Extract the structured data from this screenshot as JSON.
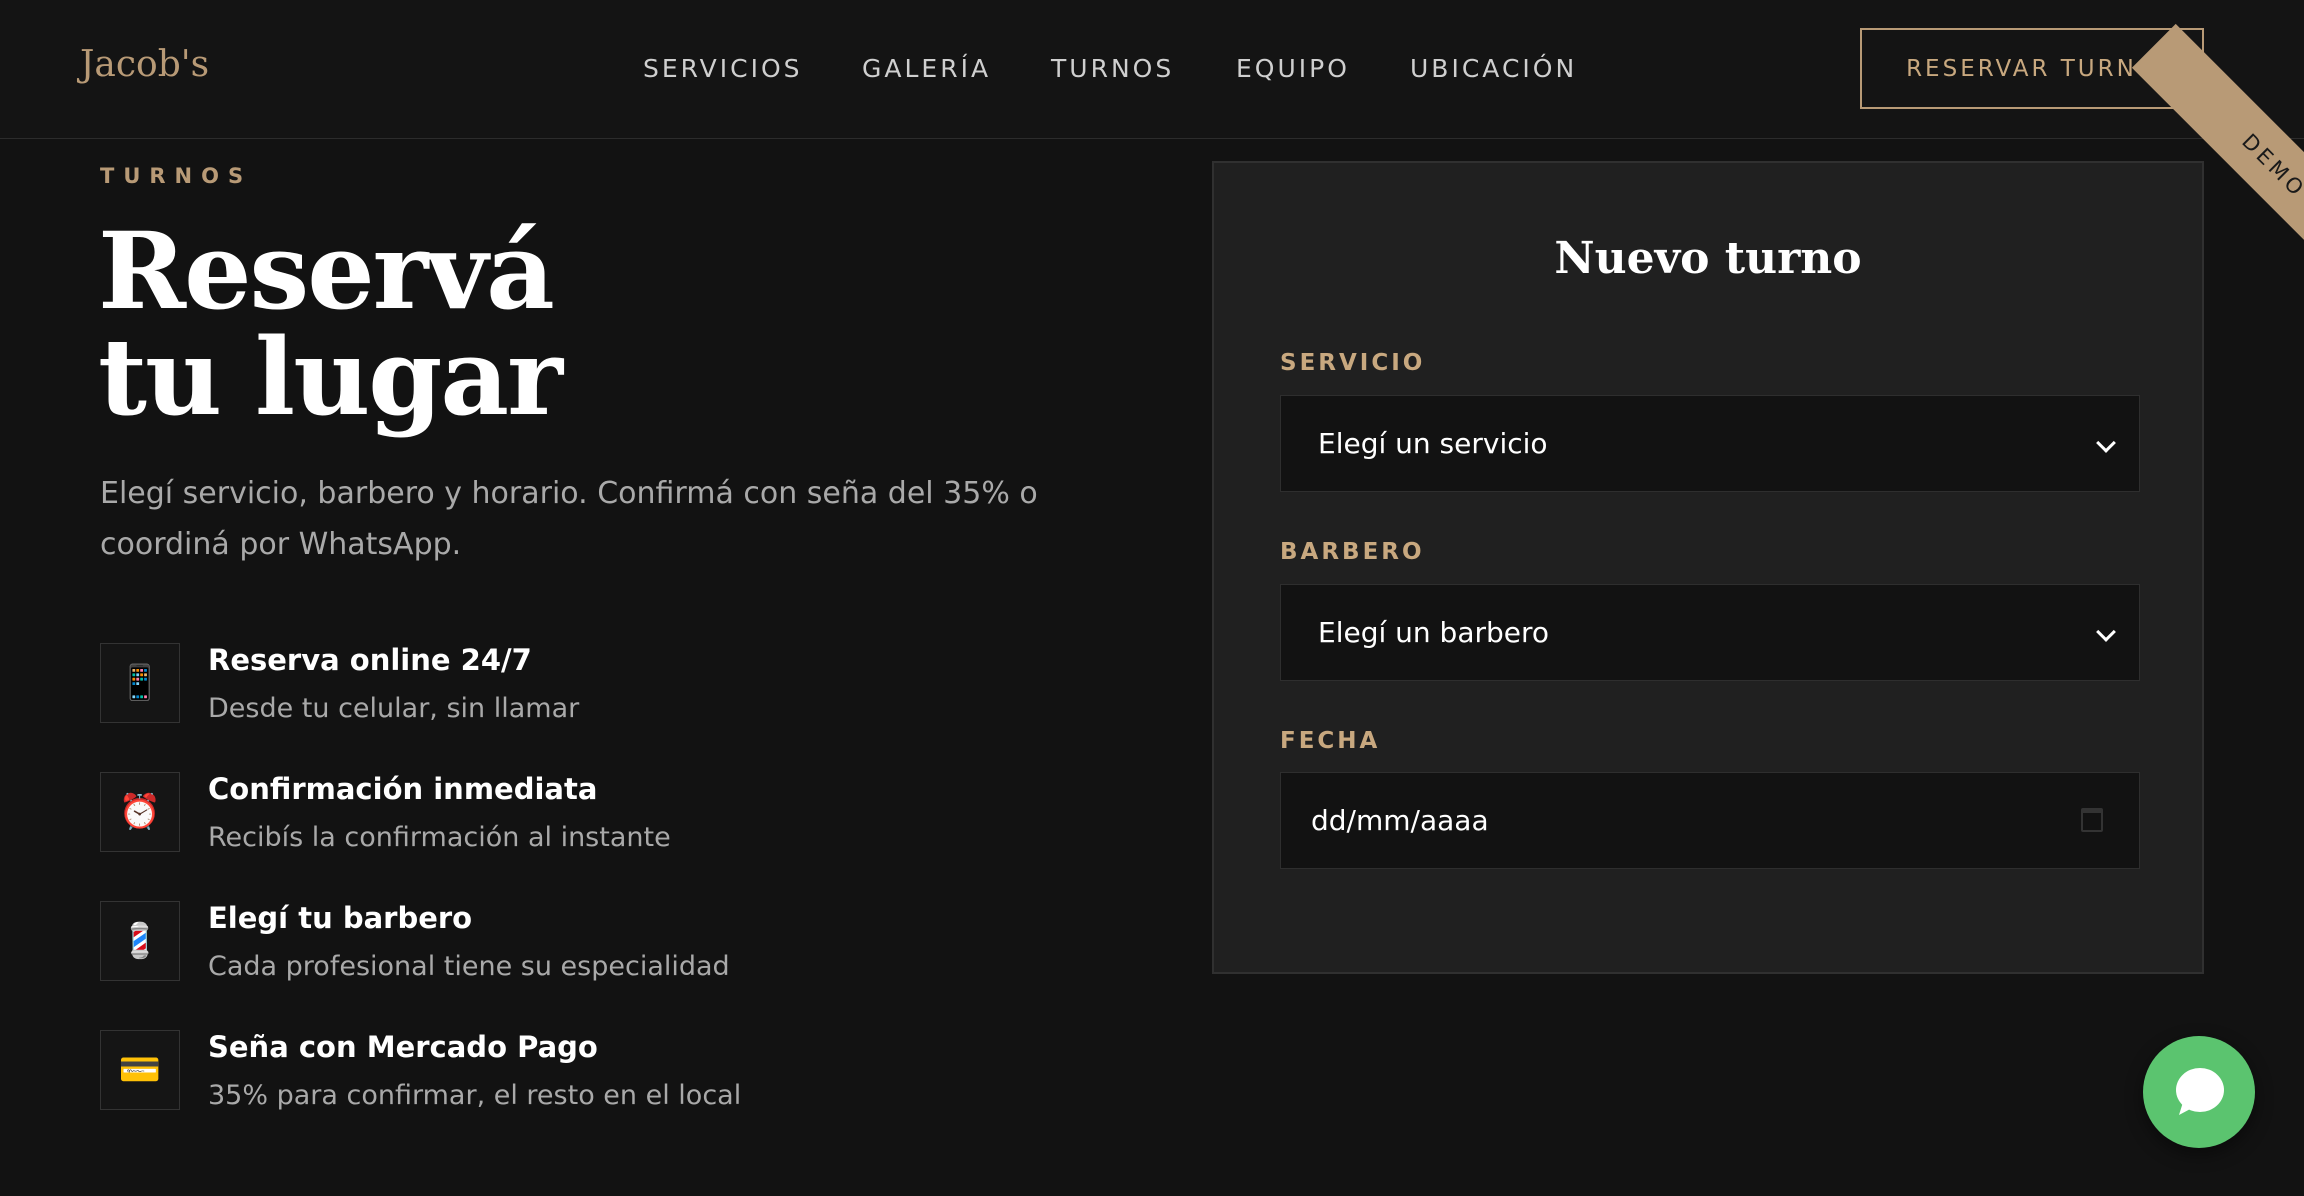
{
  "header": {
    "logo": "Jacob's",
    "nav": [
      "SERVICIOS",
      "GALERÍA",
      "TURNOS",
      "EQUIPO",
      "UBICACIÓN"
    ],
    "cta": "RESERVAR TURNO",
    "ribbon": "DEMO"
  },
  "hero": {
    "eyebrow": "TURNOS",
    "title_line1": "Reservá",
    "title_line2": "tu lugar",
    "subtitle": "Elegí servicio, barbero y horario. Confirmá con seña del 35% o coordiná por WhatsApp."
  },
  "features": [
    {
      "icon": "📱",
      "icon_name": "mobile-phone-icon",
      "title": "Reserva online 24/7",
      "desc": "Desde tu celular, sin llamar"
    },
    {
      "icon": "⏰",
      "icon_name": "alarm-clock-icon",
      "title": "Confirmación inmediata",
      "desc": "Recibís la confirmación al instante"
    },
    {
      "icon": "💈",
      "icon_name": "barber-pole-icon",
      "title": "Elegí tu barbero",
      "desc": "Cada profesional tiene su especialidad"
    },
    {
      "icon": "💳",
      "icon_name": "credit-card-icon",
      "title": "Seña con Mercado Pago",
      "desc": "35% para confirmar, el resto en el local"
    }
  ],
  "form": {
    "title": "Nuevo turno",
    "service_label": "SERVICIO",
    "service_value": "Elegí un servicio",
    "barber_label": "BARBERO",
    "barber_value": "Elegí un barbero",
    "date_label": "FECHA",
    "date_placeholder": "dd/mm/aaaa"
  },
  "colors": {
    "background": "#121212",
    "accent": "#b89a76",
    "card": "#202020",
    "whatsapp": "#5bc46f"
  },
  "floating": {
    "icon_name": "whatsapp-chat-icon"
  }
}
